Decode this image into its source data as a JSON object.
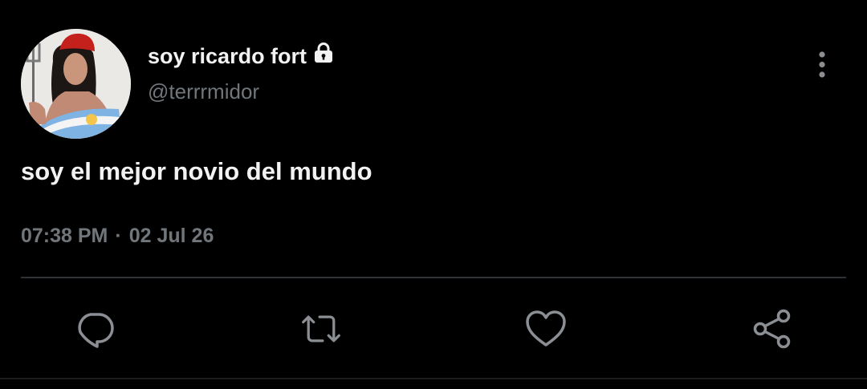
{
  "tweet": {
    "display_name": "soy ricardo fort",
    "handle": "@terrrmidor",
    "text": "soy el mejor novio del mundo",
    "time": "07:38 PM",
    "separator": "·",
    "date": "02 Jul 26",
    "protected_icon": "lock-icon",
    "more_icon": "more-vertical-icon"
  },
  "actions": [
    {
      "name": "reply",
      "icon": "reply-icon"
    },
    {
      "name": "retweet",
      "icon": "retweet-icon"
    },
    {
      "name": "like",
      "icon": "heart-icon"
    },
    {
      "name": "share",
      "icon": "share-icon"
    }
  ],
  "colors": {
    "background": "#000000",
    "primary_text": "#f2f2f2",
    "secondary_text": "#71767b",
    "divider": "#2f3336"
  }
}
